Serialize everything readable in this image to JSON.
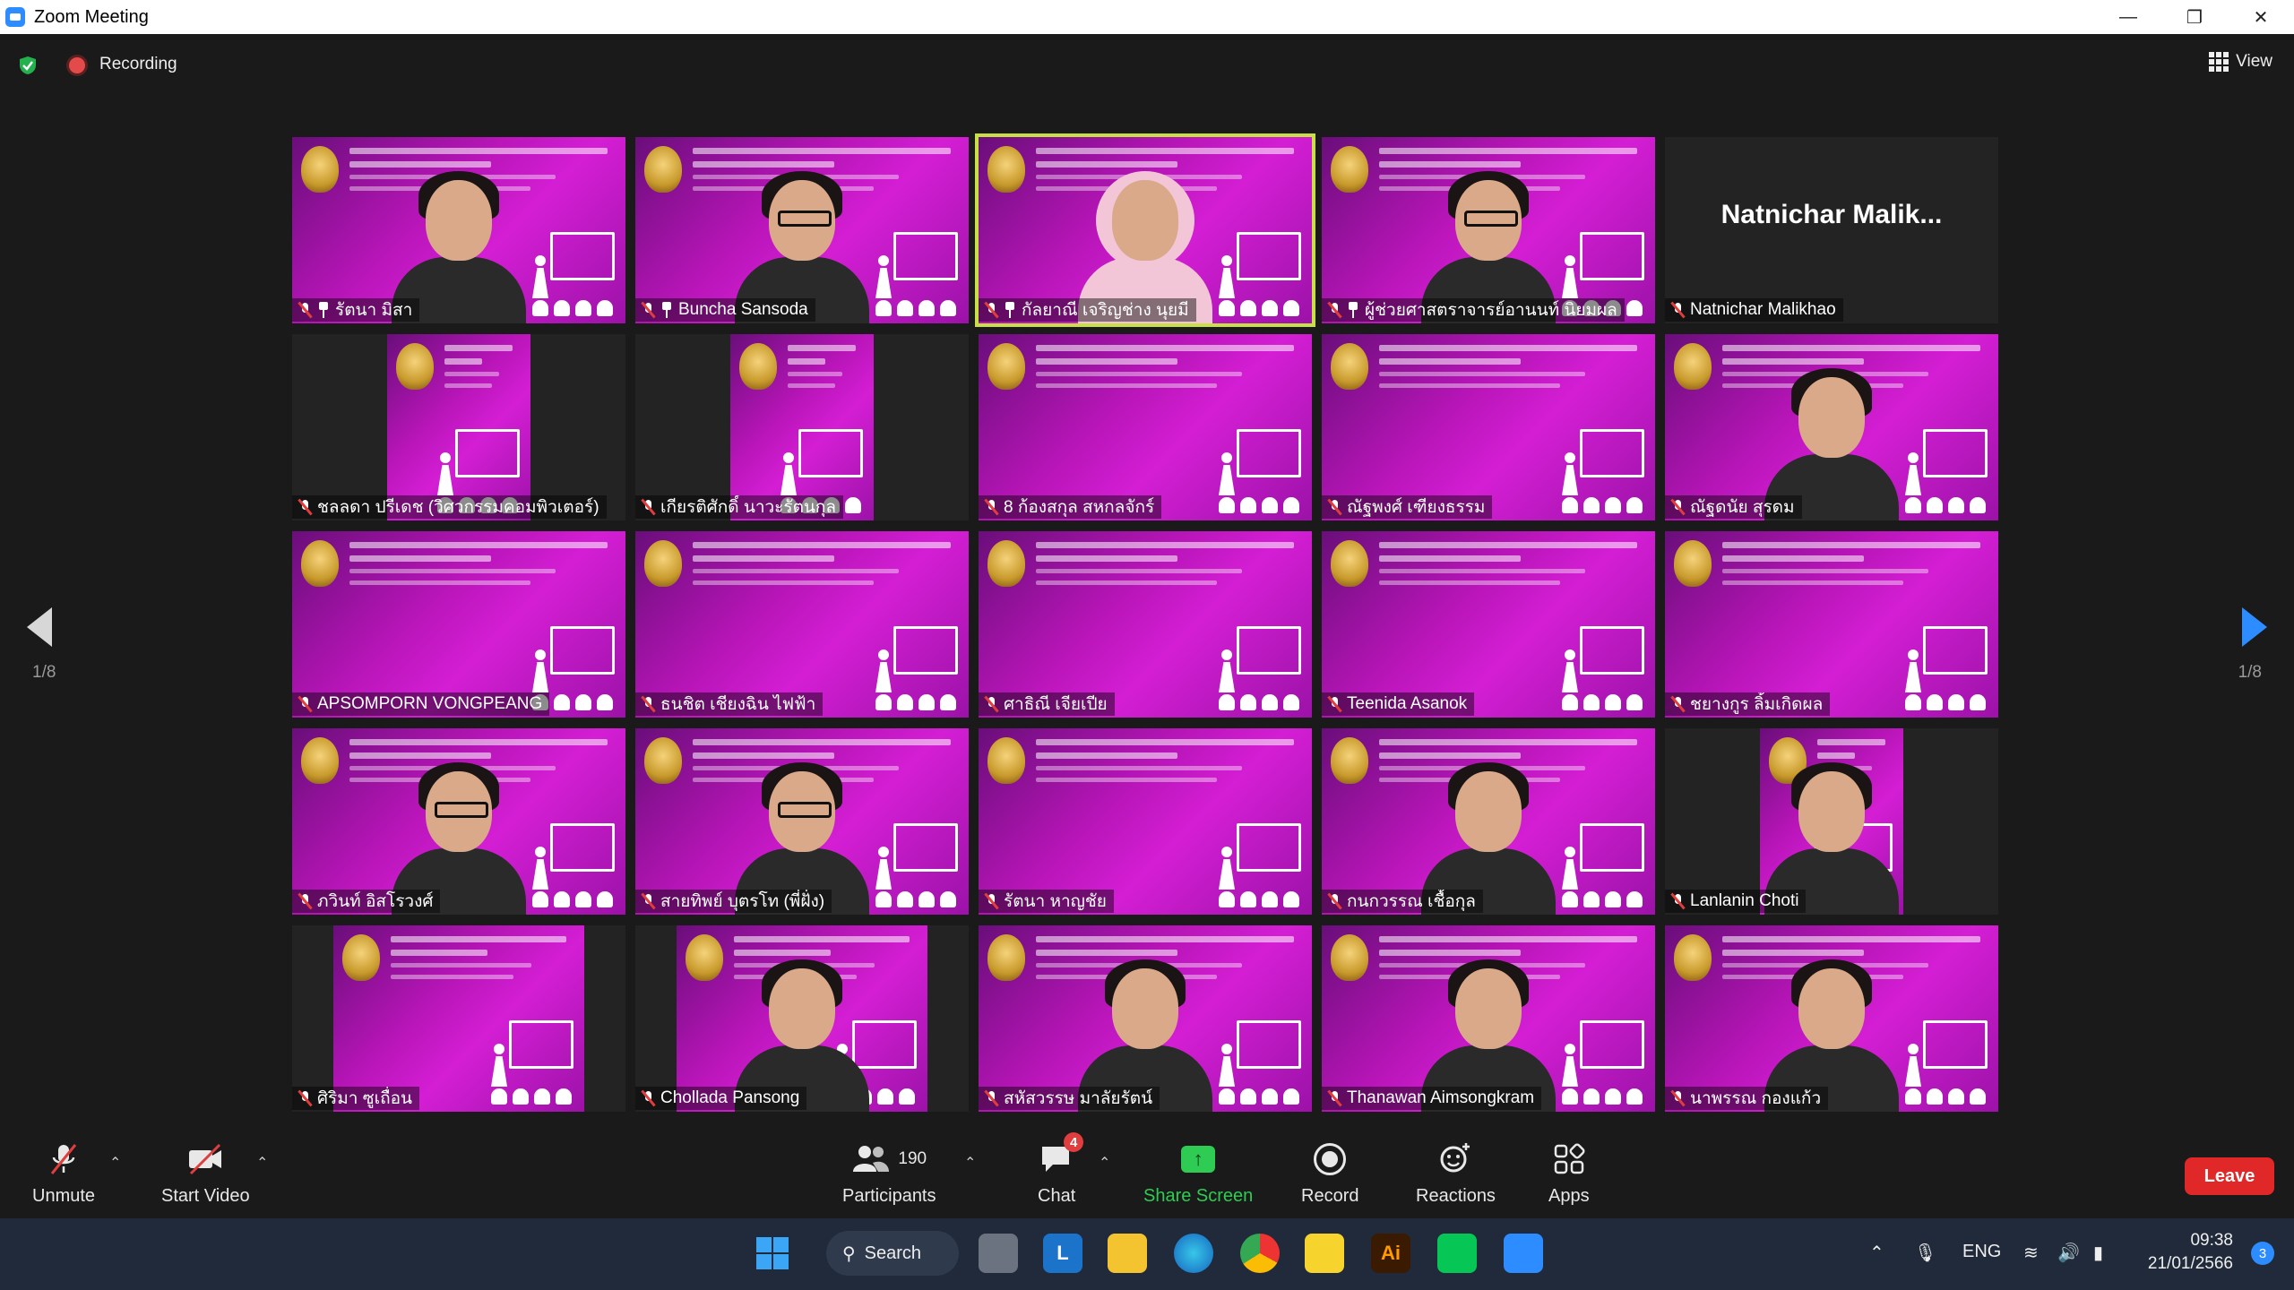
{
  "window": {
    "title": "Zoom Meeting"
  },
  "topbar": {
    "recording_label": "Recording",
    "view_label": "View"
  },
  "pagination": {
    "left": "1/8",
    "right": "1/8"
  },
  "participants_tiles": [
    {
      "name": "รัตนา มิสา",
      "video": "person",
      "pinned": true
    },
    {
      "name": "Buncha Sansoda",
      "video": "person-glasses",
      "pinned": true
    },
    {
      "name": "กัลยาณี เจริญช่าง นุยมี",
      "video": "person-hijab",
      "pinned": true,
      "active_speaker": true
    },
    {
      "name": "ผู้ช่วยศาสตราจารย์อานนท์ นิยมผล",
      "video": "person-glasses",
      "pinned": true
    },
    {
      "name": "Natnichar Malikhao",
      "video": "none",
      "display_name": "Natnichar  Malik..."
    },
    {
      "name": "ชลลดา ปรีเดช (วิศวกรรมคอมพิวเตอร์)",
      "video": "slide-narrow"
    },
    {
      "name": "เกียรติศักดิ์ นาวะรัตนกุล",
      "video": "slide-narrow"
    },
    {
      "name": "8 ก้องสกุล สหกลจักร์",
      "video": "slide"
    },
    {
      "name": "ณัฐพงศ์ เฑียงธรรม",
      "video": "slide"
    },
    {
      "name": "ณัฐดนัย สุรดม",
      "video": "person"
    },
    {
      "name": "APSOMPORN VONGPEANG",
      "video": "slide"
    },
    {
      "name": "ธนชิต เชียงฉิน ไฟฟ้า",
      "video": "slide"
    },
    {
      "name": "ศาธิณี เจียเปีย",
      "video": "slide"
    },
    {
      "name": "Teenida Asanok",
      "video": "slide"
    },
    {
      "name": "ชยางกูร ลิ้มเกิดผล",
      "video": "slide"
    },
    {
      "name": "ภวินท์ อิสโรวงศ์",
      "video": "person-glasses"
    },
    {
      "name": "สายทิพย์ บุตรโท (พี่ฝั่ง)",
      "video": "person-glasses"
    },
    {
      "name": "รัตนา หาญชัย",
      "video": "slide"
    },
    {
      "name": "กนกวรรณ เชื้อกุล",
      "video": "person"
    },
    {
      "name": "Lanlanin Choti",
      "video": "person-narrow"
    },
    {
      "name": "ศิริมา ซูเถื่อน",
      "video": "slide-mid"
    },
    {
      "name": "Chollada Pansong",
      "video": "person-mid"
    },
    {
      "name": "สหัสวรรษ มาลัยรัตน์",
      "video": "person"
    },
    {
      "name": "Thanawan Aimsongkram",
      "video": "person"
    },
    {
      "name": "นาพรรณ กองแก้ว",
      "video": "person"
    }
  ],
  "toolbar": {
    "unmute": "Unmute",
    "start_video": "Start Video",
    "participants": "Participants",
    "participants_count": "190",
    "chat": "Chat",
    "chat_badge": "4",
    "share_screen": "Share Screen",
    "record": "Record",
    "reactions": "Reactions",
    "apps": "Apps",
    "leave": "Leave"
  },
  "taskbar": {
    "search": "Search",
    "language": "ENG",
    "time": "09:38",
    "date": "21/01/2566",
    "notifications": "3"
  },
  "colors": {
    "share_green": "#2ecc52",
    "leave_red": "#e02828",
    "active_speaker_outline": "#c8e045",
    "slide_magenta": "#c417c4",
    "zoom_blue": "#2d8cff"
  }
}
